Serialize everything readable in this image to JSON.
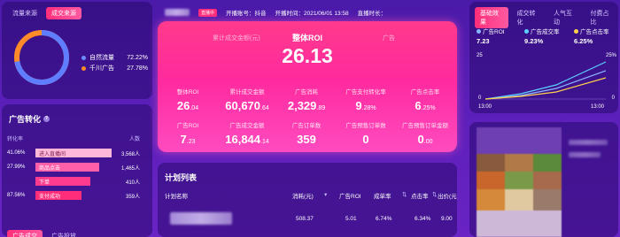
{
  "left_top": {
    "tabs": [
      "流量来源",
      "成交来源"
    ],
    "legend": [
      {
        "label": "自然流量",
        "value": "72.22%",
        "color": "#6a8cff"
      },
      {
        "label": "千川广告",
        "value": "27.78%",
        "color": "#ff8a2a"
      }
    ],
    "ring": {
      "natural": 72.22,
      "ad": 27.78
    }
  },
  "left_bottom": {
    "title": "广告转化",
    "col_left": "转化率",
    "col_right": "人数",
    "rows": [
      {
        "pct": "41.06%",
        "label": "进入直播间",
        "num": "3,568人",
        "width": 118,
        "color": "#ffb8d8"
      },
      {
        "pct": "27.99%",
        "label": "商品点击",
        "num": "1,465人",
        "width": 96,
        "color": "#ff5fa8"
      },
      {
        "pct": "",
        "label": "下单",
        "num": "410人",
        "width": 78,
        "color": "#ff3b8f"
      },
      {
        "pct": "87.56%",
        "label": "支付成功",
        "num": "359人",
        "width": 62,
        "color": "#ff2d7a"
      }
    ],
    "bottom_tabs": [
      "广告成交",
      "广告投放"
    ]
  },
  "center_header": {
    "badge": "直播中",
    "platform": "开播账号：抖音",
    "start_time": "开播时间：2021/06/01 13:58",
    "duration": "直播时长："
  },
  "center_top": {
    "left_label": "累计成交金额(元)",
    "main_label": "整体ROI",
    "main_value": "26.13",
    "right_label": "广告",
    "cells": [
      {
        "label": "整体ROI",
        "int": "26",
        "dec": ".04"
      },
      {
        "label": "累计成交金额",
        "int": "60,670",
        "dec": ".64"
      },
      {
        "label": "广告消耗",
        "int": "2,329",
        "dec": ".89"
      },
      {
        "label": "广告支付转化率",
        "int": "9",
        "dec": ".28%"
      },
      {
        "label": "广告点击率",
        "int": "6",
        "dec": ".25%"
      },
      {
        "label": "广告ROI",
        "int": "7",
        "dec": ".23"
      },
      {
        "label": "广告成交金额",
        "int": "16,844",
        "dec": ".14"
      },
      {
        "label": "广告订单数",
        "int": "359",
        "dec": ""
      },
      {
        "label": "广告预售订单数",
        "int": "0",
        "dec": ""
      },
      {
        "label": "广告预售订单金额",
        "int": "0",
        "dec": ".00"
      }
    ]
  },
  "center_bottom": {
    "title": "计划列表",
    "headers": [
      "计划名称",
      "消耗(元)",
      "广告ROI",
      "成单率",
      "点击率",
      "出价(元)"
    ],
    "row": [
      "508.37",
      "5.01",
      "6.74%",
      "6.34%",
      "9.00"
    ]
  },
  "right_top": {
    "tabs": [
      "基础效果",
      "成交转化",
      "人气互动",
      "付费占比"
    ],
    "legend": [
      {
        "label": "广告ROI",
        "value": "7.23",
        "color": "#8ab4ff"
      },
      {
        "label": "广告成交率",
        "value": "9.23%",
        "color": "#5ad1ff"
      },
      {
        "label": "广告点击率",
        "value": "6.25%",
        "color": "#ffd24a"
      }
    ],
    "axis": {
      "y_left_top": "25",
      "y_left_zero": "0",
      "y_right_top": "25%",
      "y_right_zero": "0",
      "x_start": "13:00",
      "x_end": "13:00"
    }
  },
  "colors": {
    "accent": "#ff2d7a",
    "panel": "#2a0a6e",
    "bg": "#5a1fb8"
  }
}
